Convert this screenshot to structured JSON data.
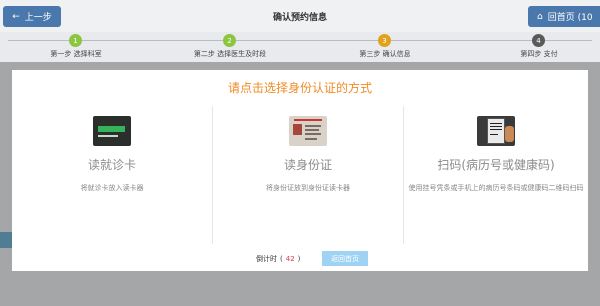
{
  "header": {
    "back_label": "上一步",
    "back_icon": "arrow-left-icon",
    "title": "确认预约信息",
    "home_label": "回首页 (10",
    "home_icon": "home-icon"
  },
  "steps": [
    {
      "num": "1",
      "label": "第一步 选择科室",
      "color": "#8cc63f"
    },
    {
      "num": "2",
      "label": "第二步 选择医生及时段",
      "color": "#8cc63f"
    },
    {
      "num": "3",
      "label": "第三步 确认信息",
      "color": "#e0a21a"
    },
    {
      "num": "4",
      "label": "第四步 支付",
      "color": "#5a5a5a"
    }
  ],
  "modal": {
    "title": "请点击选择身份认证的方式",
    "options": [
      {
        "name": "读就诊卡",
        "desc": "将就诊卡放入读卡器",
        "icon": "medical-card-image"
      },
      {
        "name": "读身份证",
        "desc": "将身份证放到身份证读卡器",
        "icon": "id-card-image"
      },
      {
        "name": "扫码(病历号或健康码)",
        "desc": "使用挂号凭条或手机上的病历号条码或健康码二维码扫码",
        "icon": "scan-code-image"
      }
    ],
    "countdown_label": "倒计时",
    "countdown_open": "(",
    "countdown_value": "42",
    "countdown_close": ")",
    "return_label": "返回首页"
  },
  "colors": {
    "accent_orange": "#f08b26",
    "button_blue": "#4a78ad",
    "return_button": "#9fd3f3",
    "countdown_red": "#e23b3b"
  }
}
